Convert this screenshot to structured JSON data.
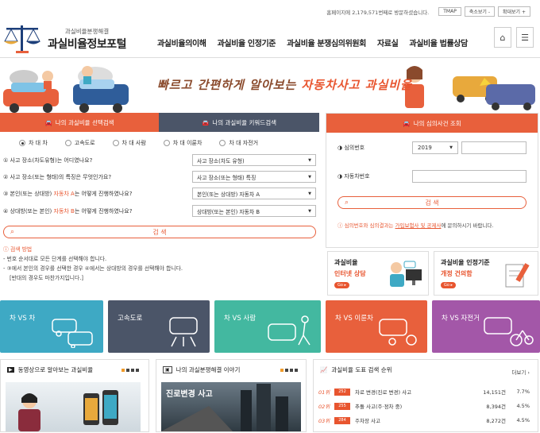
{
  "topbar": {
    "visit_text": "홈페이지에 2,179,571번째로 방문하셨습니다.",
    "buttons": [
      "TMAP",
      "축소보기 -",
      "확대보기 +"
    ]
  },
  "logo": {
    "subtitle": "과실비율분쟁해결",
    "title": "과실비율정보포털"
  },
  "nav": [
    "과실비율의이해",
    "과실비율 인정기준",
    "과실비율 분쟁심의위원회",
    "자료실",
    "과실비율 법률상담"
  ],
  "banner": {
    "text_a": "빠르고 간편하게 알아보는 ",
    "text_b": "자동차사고 과실비율"
  },
  "left_panel": {
    "tab_active": "나의 과실비율 선택검색",
    "tab_other": "나의 과실비율 키워드검색",
    "radios": [
      "차 대 차",
      "고속도로",
      "차 대 사람",
      "차 대 이륜차",
      "차 대 자전거"
    ],
    "questions": [
      {
        "q": "① 사고 장소(차도유형)는 어디였나요?",
        "select": "사고 장소(차도 유형)"
      },
      {
        "q": "② 사고 장소(또는 형태)의 특징은 무엇인가요?",
        "select": "사고 장소(또는 형태) 특징"
      },
      {
        "q_a": "③ 본인(또는 상대방) ",
        "q_hl": "자동차 A",
        "q_b": "는 어떻게 진행하였나요?",
        "select": "본인(또는 상대방) 자동차 A"
      },
      {
        "q_a": "④ 상대방(또는 본인) ",
        "q_hl": "자동차 B",
        "q_b": "는 어떻게 진행하였나요?",
        "select": "상대방(또는 본인) 자동차 B"
      }
    ],
    "search_label": "검 색",
    "method_title": "ⓘ 검색 방법",
    "method_lines": [
      "- 번호 순서대로 모든 단계를 선택해야 합니다.",
      "- ③에서 본인의 경우를 선택한 경우 ④에서는 상대방의 경우를 선택해야 합니다.",
      "  [반대의 경우도 마찬가지입니다.]"
    ]
  },
  "right_panel": {
    "tab": "나의 심의사건 조회",
    "label_number": "◑ 심의번호",
    "year": "2019",
    "label_car": "◑ 자동차번호",
    "search_label": "검 색",
    "note_a": "ⓘ 심의번호와 심의결과는 ",
    "note_link": "가입보험사 및 공제사",
    "note_b": "에 문의하시기 바랍니다."
  },
  "boxes": [
    {
      "title": "과실비율",
      "sub": "인터넷 상담",
      "go": "Go ▸"
    },
    {
      "title": "과실비율 인정기준",
      "sub": "개정 건의함",
      "go": "Go ▸"
    }
  ],
  "tiles": [
    {
      "label": "차 VS 차",
      "color": "#3ea9c4"
    },
    {
      "label": "고속도로",
      "color": "#4b5568"
    },
    {
      "label": "차 VS 사람",
      "color": "#43b8a0"
    },
    {
      "label": "차 VS 이륜차",
      "color": "#e8603c"
    },
    {
      "label": "차 VS 자전거",
      "color": "#a357a8"
    }
  ],
  "bottom": {
    "video_title": "동영상으로 알아보는 과실비율",
    "story_title": "나의 과실분쟁해결 이야기",
    "story_caption": "진로변경 사고",
    "ranking_title": "과실비율 도표 검색 순위",
    "more": "더보기 ›",
    "ranking": [
      {
        "rank": "01위",
        "code": "252",
        "name": "차로 변경(진로 변경) 사고",
        "count": "14,151건",
        "pct": "7.7%"
      },
      {
        "rank": "02위",
        "code": "255",
        "name": "추돌 사고(주·정차 중)",
        "count": "8,394건",
        "pct": "4.5%"
      },
      {
        "rank": "03위",
        "code": "284",
        "name": "주차장 사고",
        "count": "8,272건",
        "pct": "4.5%"
      }
    ]
  }
}
